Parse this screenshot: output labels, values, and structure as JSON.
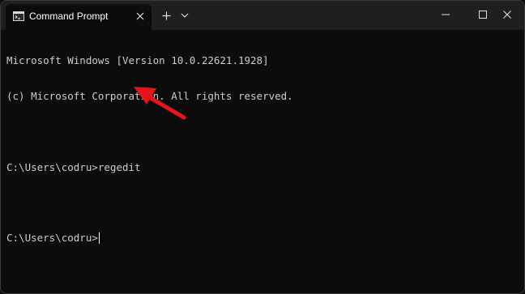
{
  "window": {
    "tab_title": "Command Prompt",
    "accent_arrow_color": "#e8141b"
  },
  "terminal": {
    "lines": [
      "Microsoft Windows [Version 10.0.22621.1928]",
      "(c) Microsoft Corporation. All rights reserved.",
      "",
      "C:\\Users\\codru>regedit",
      "",
      "C:\\Users\\codru>"
    ]
  },
  "icons": {
    "tab_icon": "terminal-icon",
    "tab_close": "close-icon",
    "new_tab": "plus-icon",
    "dropdown": "chevron-down-icon",
    "minimize": "minimize-icon",
    "maximize": "maximize-icon",
    "close": "close-icon",
    "annotation": "red-arrow-icon"
  }
}
